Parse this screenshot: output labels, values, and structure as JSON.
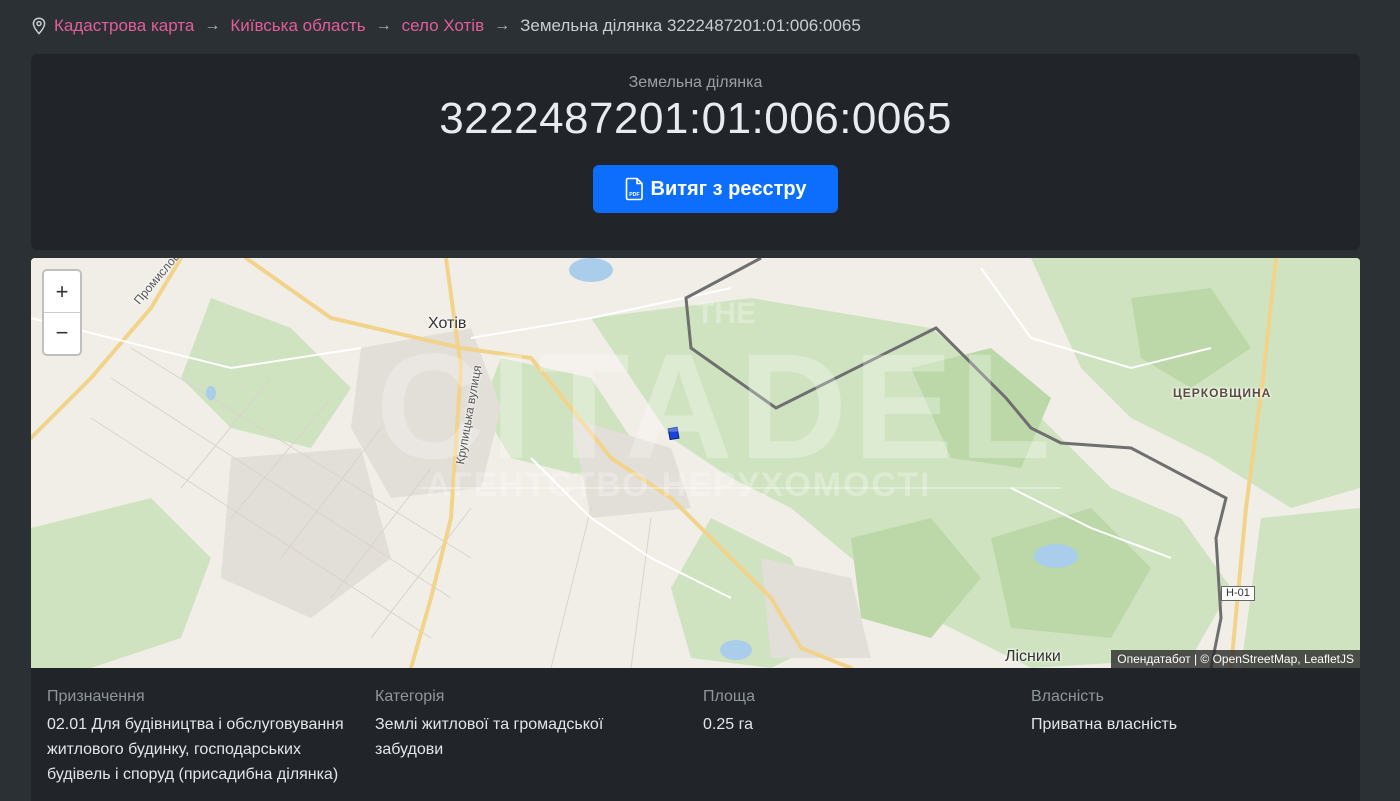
{
  "breadcrumb": {
    "items": [
      "Кадастрова карта",
      "Київська область",
      "село Хотів"
    ],
    "current": "Земельна ділянка 3222487201:01:006:0065",
    "separator": "→"
  },
  "header": {
    "subtitle": "Земельна ділянка",
    "cadastral_number": "3222487201:01:006:0065",
    "extract_button": "Витяг з реєстру"
  },
  "map": {
    "zoom_in": "+",
    "zoom_out": "−",
    "labels": {
      "khotiv": "Хотів",
      "promyslova": "Промислова вулиця",
      "krupytska": "Крупицька вулиця",
      "tserkovshchyna": "ЦЕРКОВЩИНА",
      "lisnyky": "Лісники",
      "road": "Н-01"
    },
    "watermark": {
      "line1": "THE",
      "line2": "CITADEL",
      "line3": "АГЕНТСТВО НЕРУХОМОСТІ"
    },
    "attribution": {
      "source": "Опендатабот",
      "osm": "© OpenStreetMap",
      "leaflet": "LeafletJS"
    }
  },
  "info": {
    "purpose": {
      "label": "Призначення",
      "value": "02.01 Для будівництва і обслуговування житлового будинку, господарських будівель і споруд (присадибна ділянка)"
    },
    "category": {
      "label": "Категорія",
      "value": "Землі житлової та громадської забудови"
    },
    "area": {
      "label": "Площа",
      "value": "0.25 га"
    },
    "ownership": {
      "label": "Власність",
      "value": "Приватна власність"
    }
  },
  "colors": {
    "link": "#e35d9a",
    "primary_button": "#0d6efd",
    "card_bg": "#212529",
    "page_bg": "#2b3035"
  }
}
